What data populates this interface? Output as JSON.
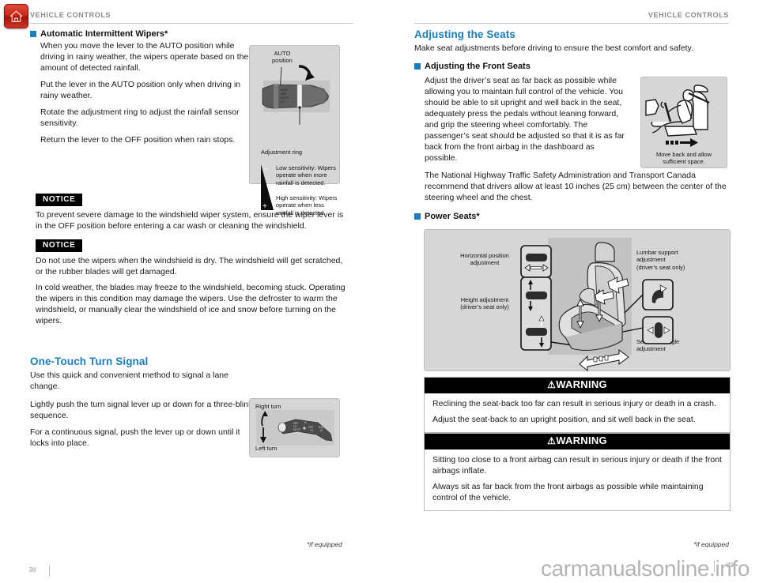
{
  "home_icon": "home-icon",
  "left_page": {
    "header": "VEHICLE CONTROLS",
    "page_number": "38",
    "footnote": "*if equipped",
    "section_wipers": {
      "heading": "Automatic Intermittent Wipers*",
      "paragraphs": [
        "When you move the lever to the AUTO position while driving in rainy weather, the wipers operate based on the amount of detected rainfall.",
        "Put the lever in the AUTO position only when driving in rainy weather.",
        "Rotate the adjustment ring to adjust the rainfall sensor sensitivity.",
        "Return the lever to the OFF position when rain stops."
      ]
    },
    "figure_wiper": {
      "label_auto": "AUTO\nposition",
      "label_auto_line1": "AUTO",
      "label_auto_line2": "position",
      "label_ring": "Adjustment ring",
      "minus_sign": "–",
      "plus_sign": "+",
      "low_sensitivity": "Low sensitivity: Wipers operate when more rainfall is detected.",
      "high_sensitivity": "High sensitivity: Wipers operate when less rainfall is detected."
    },
    "notice_1": {
      "tag": "NOTICE",
      "body": [
        "To prevent severe damage to the windshield wiper system, ensure the wiper lever is in the OFF position before entering a car wash or cleaning the windshield."
      ]
    },
    "notice_2": {
      "tag": "NOTICE",
      "body": [
        "Do not use the wipers when the windshield is dry. The windshield will get scratched, or the rubber blades will get damaged.",
        "In cold weather, the blades may freeze to the windshield, becoming stuck. Operating the wipers in this condition may damage the wipers. Use the defroster to warm the windshield, or manually clear the windshield of ice and snow before turning on the wipers."
      ]
    },
    "section_turn_signal": {
      "heading": "One-Touch Turn Signal",
      "lead": "Use this quick and convenient method to signal a lane change.",
      "paragraphs": [
        "Lightly push the turn signal lever up or down for a three-blink sequence.",
        "For a continuous signal, push the lever up or down until it locks into place."
      ]
    },
    "figure_turn_signal": {
      "label_right": "Right turn",
      "label_left": "Left turn"
    }
  },
  "right_page": {
    "header": "VEHICLE CONTROLS",
    "page_number": "39",
    "footnote": "*if equipped",
    "section_seats": {
      "heading": "Adjusting the Seats",
      "lead": "Make seat adjustments before driving to ensure the best comfort and safety.",
      "sub_heading": "Adjusting the Front Seats",
      "paragraphs": [
        "Adjust the driver’s seat as far back as possible while allowing you to maintain full control of the vehicle. You should be able to sit upright and well back in the seat, adequately press the pedals without leaning forward, and grip the steering wheel comfortably. The passenger’s seat should be adjusted so that it is as far back from the front airbag in the dashboard as possible.",
        "The National Highway Traffic Safety Administration and Transport Canada recommend that drivers allow at least 10 inches (25 cm) between the center of the steering wheel and the chest."
      ]
    },
    "figure_driver": {
      "caption_line1": "Move back and allow",
      "caption_line2": "sufficient space."
    },
    "section_power_seats": {
      "heading": "Power Seats*"
    },
    "figure_power_seats": {
      "label_horizontal_line1": "Horizontal position",
      "label_horizontal_line2": "adjustment",
      "label_height_line1": "Height adjustment",
      "label_height_line2": "(driver’s seat only)",
      "label_lumbar_line1": "Lumbar support",
      "label_lumbar_line2": "adjustment",
      "label_lumbar_line3": "(driver’s seat only)",
      "label_seatback_line1": "Seat-back angle",
      "label_seatback_line2": "adjustment"
    },
    "warning_1": {
      "title": "WARNING",
      "symbol": "⚠",
      "body": [
        "Reclining the seat-back too far can result in serious injury or death in a crash.",
        "Adjust the seat-back to an upright position, and sit well back in the seat."
      ]
    },
    "warning_2": {
      "title": "WARNING",
      "symbol": "⚠",
      "body": [
        "Sitting too close to a front airbag can result in serious injury or death if the front airbags inflate.",
        "Always sit as far back from the front airbags as possible while maintaining control of the vehicle."
      ]
    }
  },
  "watermark": "carmanualsonline.info",
  "colors": {
    "accent_blue": "#1a7fc1",
    "header_gray": "#8a8a8a",
    "figure_bg": "#d6d6d6",
    "home_red": "#c8271a"
  }
}
